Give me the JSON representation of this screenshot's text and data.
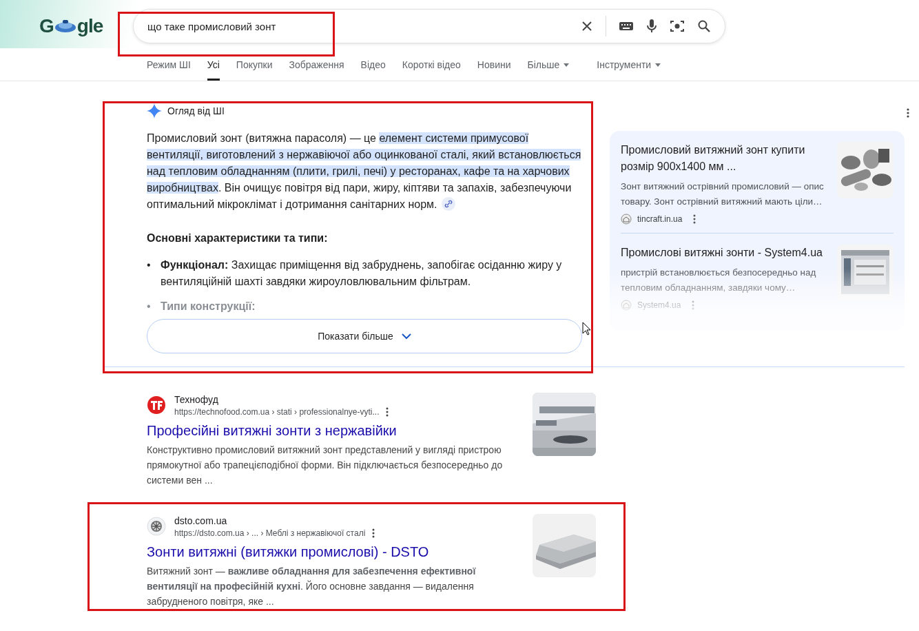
{
  "logo": {
    "left": "G",
    "right": "gle"
  },
  "search": {
    "value": "що таке промисловий зонт"
  },
  "tabs": [
    {
      "label": "Режим ШІ",
      "selected": false,
      "dropdown": false
    },
    {
      "label": "Усі",
      "selected": true,
      "dropdown": false
    },
    {
      "label": "Покупки",
      "selected": false,
      "dropdown": false
    },
    {
      "label": "Зображення",
      "selected": false,
      "dropdown": false
    },
    {
      "label": "Відео",
      "selected": false,
      "dropdown": false
    },
    {
      "label": "Короткі відео",
      "selected": false,
      "dropdown": false
    },
    {
      "label": "Новини",
      "selected": false,
      "dropdown": false
    },
    {
      "label": "Більше",
      "selected": false,
      "dropdown": true
    },
    {
      "label": "Інструменти",
      "selected": false,
      "dropdown": true
    }
  ],
  "ai_overview": {
    "title": "Огляд від ШІ",
    "paragraph": [
      {
        "text": "Промисловий зонт (витяжна парасоля) — це ",
        "highlighted": false
      },
      {
        "text": "елемент системи примусової вентиляції, виготовлений з нержавіючої або оцинкованої сталі, який встановлюється над тепловим обладнанням (плити, грилі, печі) у ресторанах, кафе та на харчових виробництвах",
        "highlighted": true
      },
      {
        "text": ". Він очищує повітря від пари, жиру, кіптяви та запахів, забезпечуючи оптимальний мікроклімат і дотримання санітарних норм.",
        "highlighted": false
      }
    ],
    "heading": "Основні характеристики та типи:",
    "bullets": [
      {
        "marker": "•",
        "label": "Функціонал:",
        "text": "Захищає приміщення від забруднень, запобігає осіданню жиру у вентиляційній шахті завдяки жироуловлювальним фільтрам.",
        "faded": false
      },
      {
        "marker": "•",
        "label": "Типи конструкції:",
        "faded": true
      }
    ],
    "show_more": "Показати більше"
  },
  "side_panel": {
    "cards": [
      {
        "title": "Промисловий витяжний зонт купити розмір 900x1400 мм ...",
        "snippet": "Зонт витяжний острівний промисловий — опис товару. Зонт острівний витяжний мають ціли…",
        "source": "tincraft.in.ua"
      },
      {
        "title": "Промислові витяжні зонти - System4.ua",
        "snippet": "пристрій встановлюється безпосередньо над тепловим обладнанням, завдяки чому…",
        "source": "System4.ua"
      }
    ]
  },
  "results": [
    {
      "site": "Технофуд",
      "url": "https://technofood.com.ua › stati › professionalnye-vyti...",
      "title": "Професійні витяжні зонти з нержавійки",
      "snippet": "Конструктивно промисловий витяжний зонт представлений у вигляді пристрою прямокутної або трапецієподібної форми. Він підключається безпосередньо до системи вен ..."
    },
    {
      "site": "dsto.com.ua",
      "url": "https://dsto.com.ua › ... › Меблі з нержавіючої сталі",
      "title": "Зонти витяжні (витяжки промислові) - DSTO",
      "snippet": "Витяжний зонт — **важливе обладнання для забезпечення ефективної вентиляції на професійній кухні**. Його основне завдання — видалення забрудненого повітря, яке ..."
    }
  ]
}
